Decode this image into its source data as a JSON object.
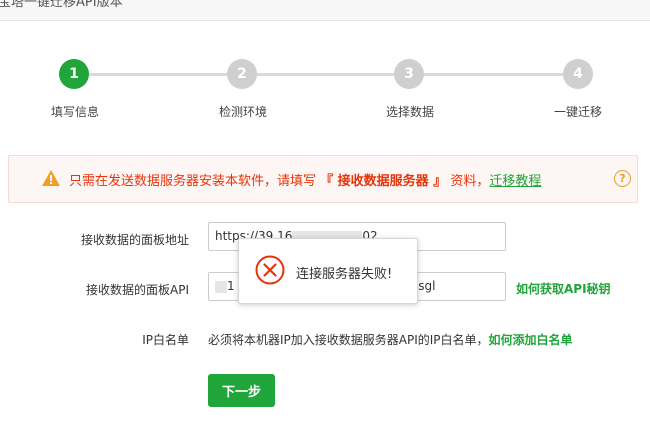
{
  "window": {
    "title": "宝塔一键迁移API版本"
  },
  "steps": [
    {
      "number": "1",
      "label": "填写信息",
      "active": true
    },
    {
      "number": "2",
      "label": "检测环境",
      "active": false
    },
    {
      "number": "3",
      "label": "选择数据",
      "active": false
    },
    {
      "number": "4",
      "label": "一键迁移",
      "active": false
    }
  ],
  "alert": {
    "text_before": "只需在发送数据服务器安装本软件，请填写",
    "highlight": "『 接收数据服务器 』",
    "text_after": "资料，",
    "link": "迁移教程",
    "help": "?"
  },
  "form": {
    "panel_address": {
      "label": "接收数据的面板地址",
      "value_prefix": "https://39.16",
      "value_suffix": "02"
    },
    "panel_api": {
      "label": "接收数据的面板API",
      "value_prefix": "1",
      "value_suffix": "hsgl",
      "help_link": "如何获取API秘钥"
    },
    "ip_whitelist": {
      "label": "IP白名单",
      "note": "必须将本机器IP加入接收数据服务器API的IP白名单，",
      "note_link": "如何添加白名单"
    },
    "next_button": "下一步"
  },
  "toast": {
    "message": "连接服务器失败!"
  },
  "colors": {
    "accent": "#20a53a",
    "warning": "#e8340a",
    "step_inactive": "#cfcfcf"
  }
}
